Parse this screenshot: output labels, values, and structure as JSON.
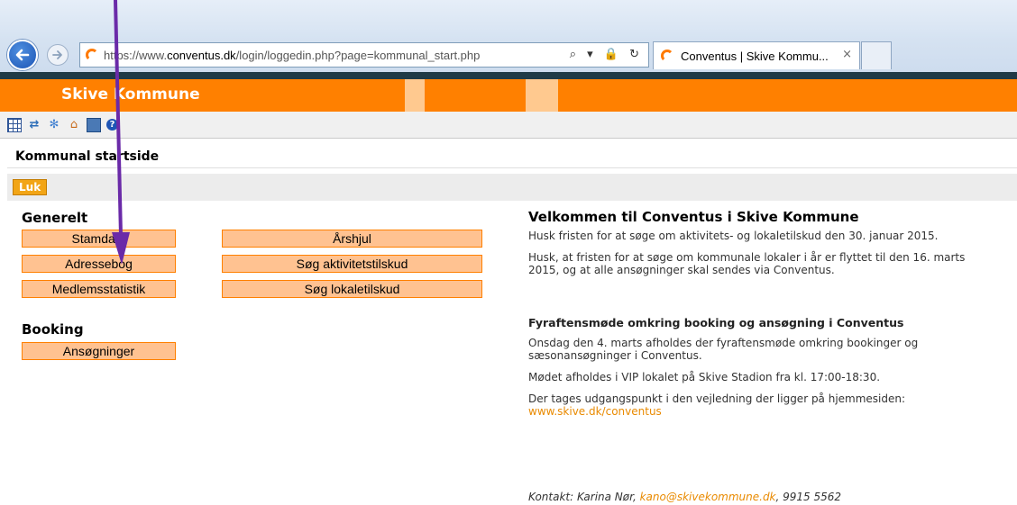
{
  "browser": {
    "url_prefix": "https://www.",
    "url_domain": "conventus.dk",
    "url_path": "/login/loggedin.php?page=kommunal_start.php",
    "address_tools": "⌕ ▾ 🔒 ↻",
    "tab_title": "Conventus | Skive Kommu...",
    "tab_close": "×"
  },
  "header": {
    "site_name": "Skive Kommune"
  },
  "toolbar": {
    "icons": [
      "table-icon",
      "transfer-arrows-icon",
      "gear-icon",
      "home-icon",
      "computer-icon",
      "help-icon"
    ]
  },
  "page": {
    "title": "Kommunal startside",
    "close_button": "Luk"
  },
  "menu": {
    "generelt_title": "Generelt",
    "stamdata": "Stamdata",
    "adressebog": "Adressebog",
    "medlemsstatistik": "Medlemsstatistik",
    "aarshjul": "Årshjul",
    "soeg_aktivitetstilskud": "Søg aktivitetstilskud",
    "soeg_lokaletilskud": "Søg lokaletilskud",
    "booking_title": "Booking",
    "ansoegninger": "Ansøgninger"
  },
  "news": {
    "welcome_title": "Velkommen til Conventus i Skive Kommune",
    "p1": "Husk fristen for at søge om aktivitets- og lokaletilskud den 30. januar 2015.",
    "p2": "Husk, at fristen for at søge om kommunale lokaler i år er flyttet til den 16. marts 2015, og at alle ansøgninger skal sendes via Conventus.",
    "meeting_title": "Fyraftensmøde omkring booking og ansøgning i Conventus",
    "p3": "Onsdag den 4. marts afholdes der fyraftensmøde omkring bookinger og sæsonansøgninger i Conventus.",
    "p4": "Mødet afholdes i VIP lokalet på Skive Stadion fra kl. 17:00-18:30.",
    "p5": "Der tages udgangspunkt i den vejledning der ligger på hjemmesiden:",
    "link": "www.skive.dk/conventus"
  },
  "contact": {
    "prefix": "Kontakt: Karina Nør,",
    "email": "kano@skivekommune.dk",
    "phone": ", 9915 5562"
  },
  "colors": {
    "brand_orange": "#ff8000",
    "button_fill": "#ffc291",
    "annotation_arrow": "#6a2aa8"
  }
}
